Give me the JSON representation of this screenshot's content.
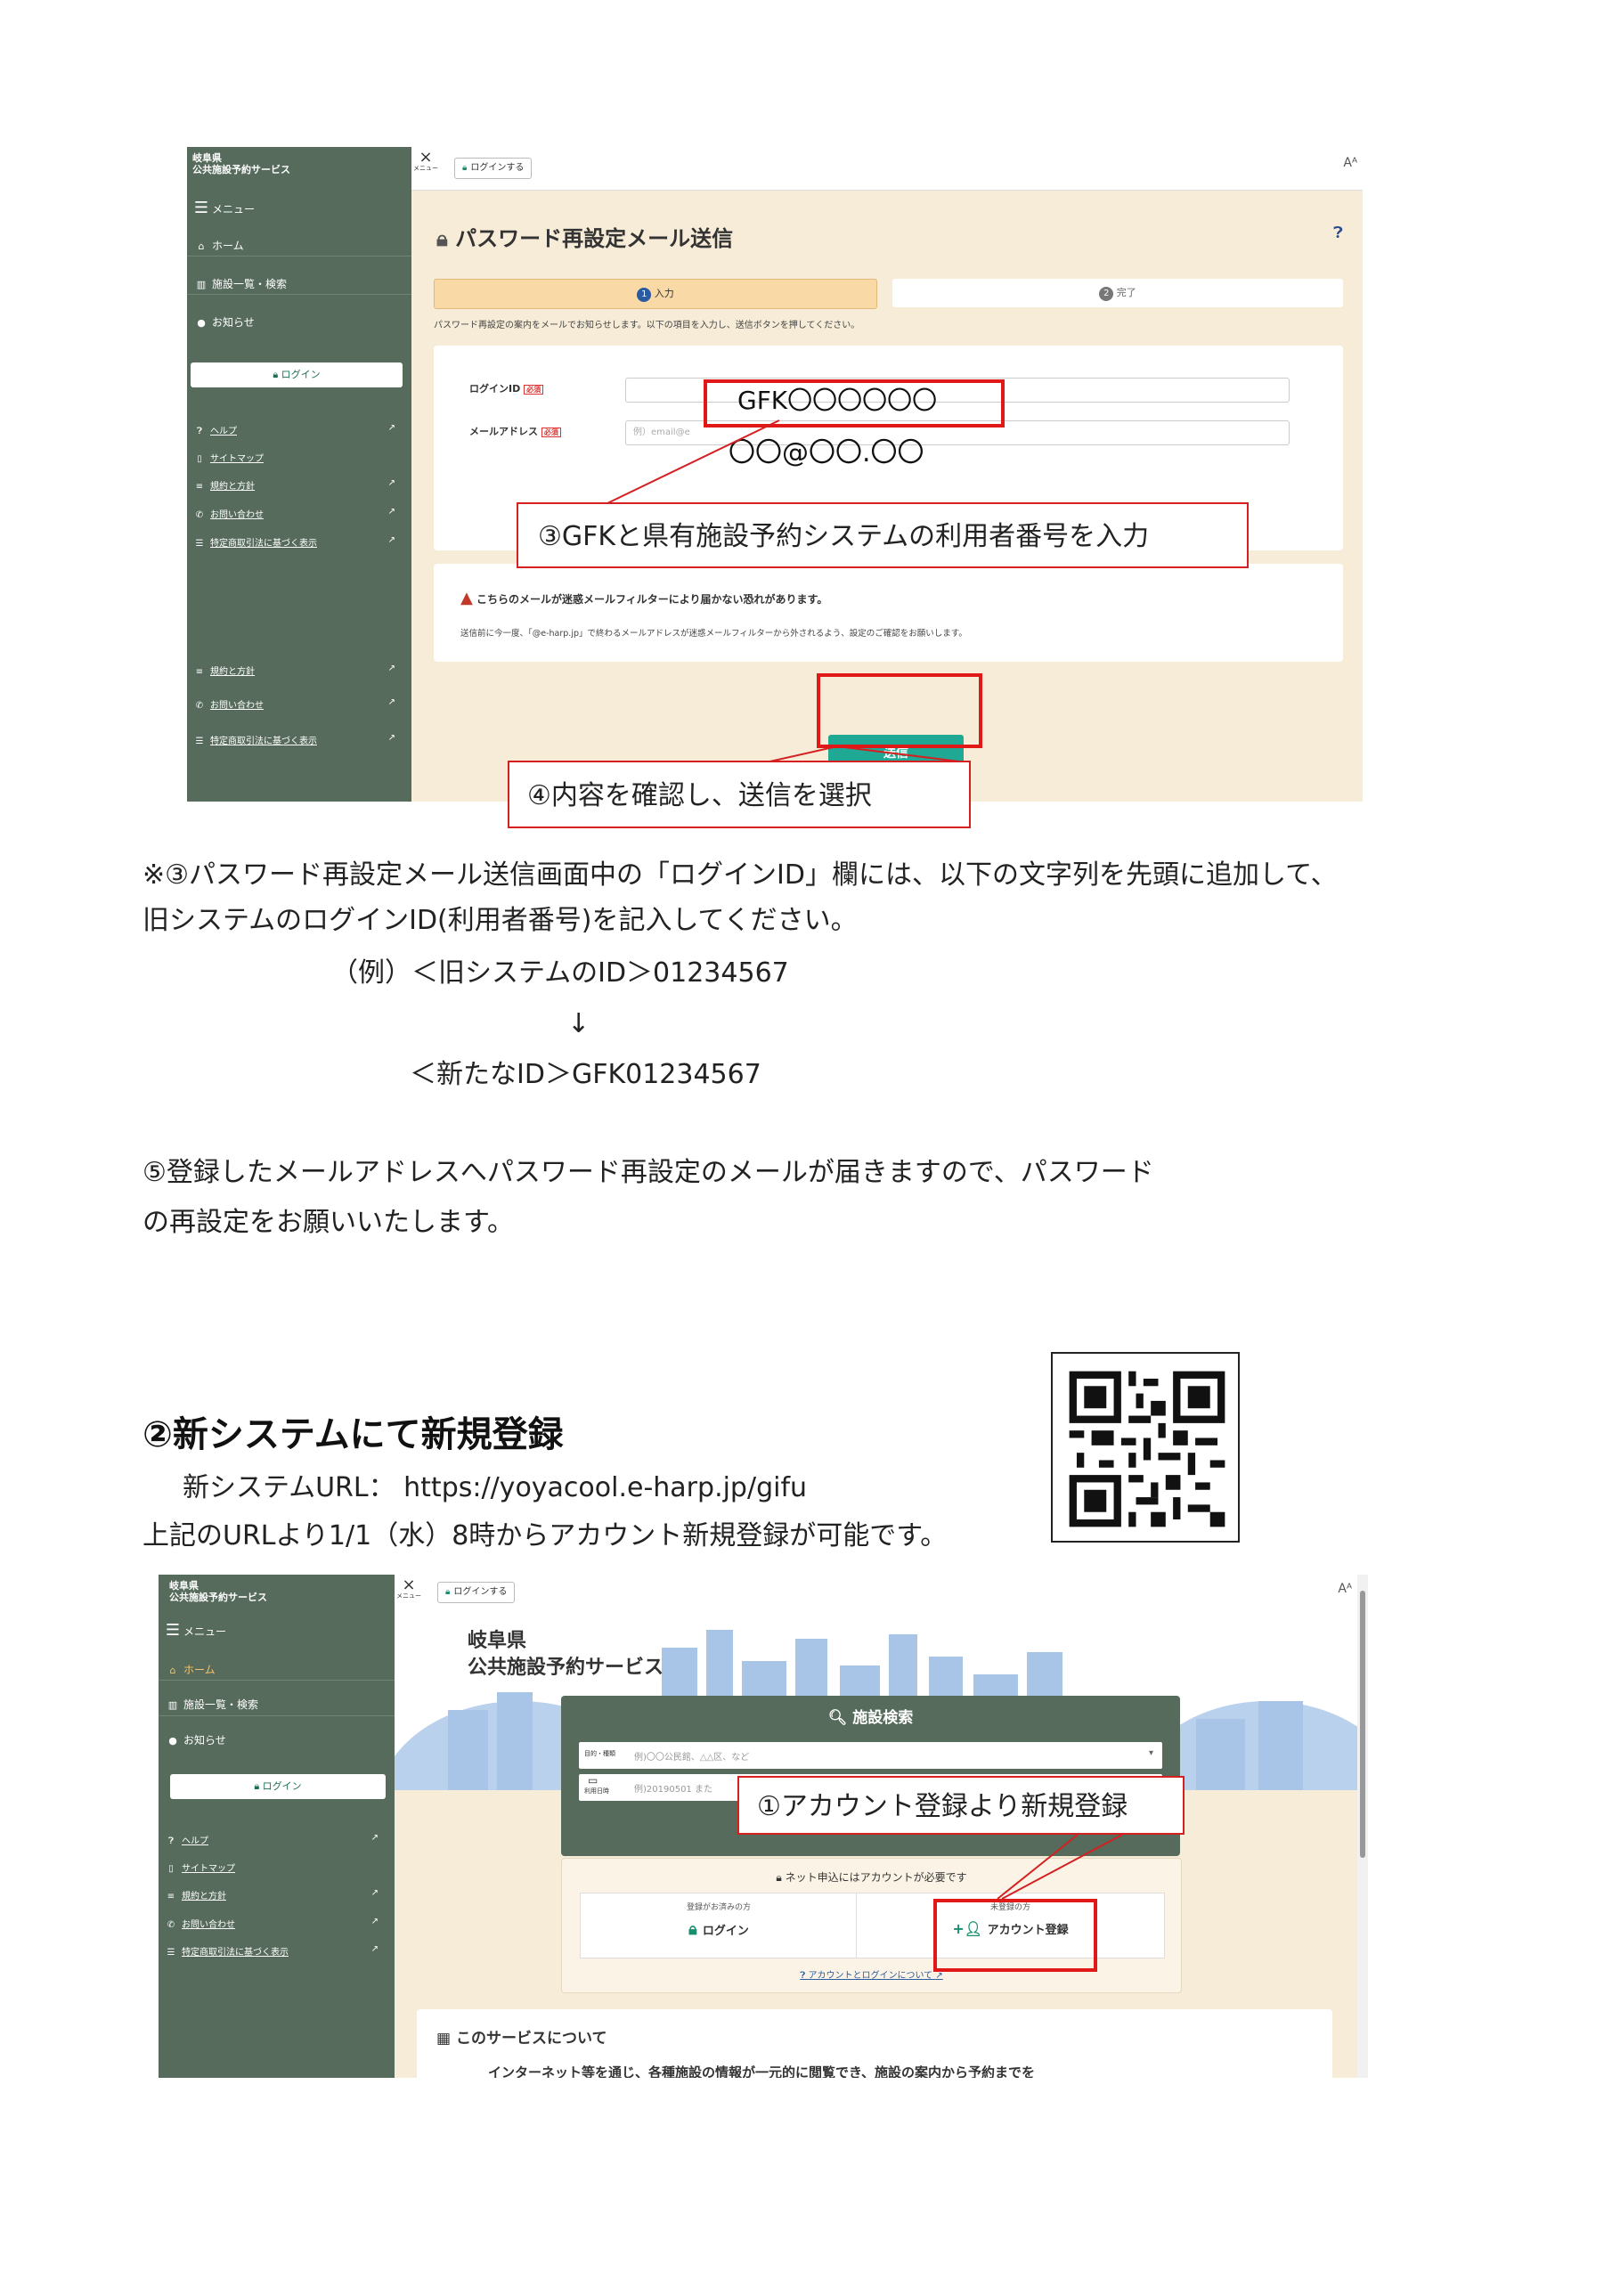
{
  "shot1": {
    "brand": "岐阜県\n公共施設予約サービス",
    "menu_label": "メニュー",
    "top_login": "ログインする",
    "page_title": "パスワード再設定メール送信",
    "steps": [
      {
        "num": "1",
        "label": "入力"
      },
      {
        "num": "2",
        "label": "完了"
      }
    ],
    "instruction": "パスワード再設定の案内をメールでお知らせします。以下の項目を入力し、送信ボタンを押してください。",
    "login_id_label": "ログインID",
    "required": "必須",
    "mail_label": "メールアドレス",
    "mail_placeholder": "例）email@e",
    "login_id_value": "GFK〇〇〇〇〇〇",
    "mail_value": "〇〇@〇〇.〇〇",
    "warning_title": "こちらのメールが迷惑メールフィルターにより届かない恐れがあります。",
    "warning_text": "送信前に今一度、「@e-harp.jp」で終わるメールアドレスが迷惑メールフィルターから外されるよう、設定のご確認をお願いします。",
    "send_button": "送信",
    "callout_input": "③GFKと県有施設予約システムの利用者番号を入力",
    "callout_send": "④内容を確認し、送信を選択",
    "sidebar": {
      "menu": "メニュー",
      "home": "ホーム",
      "facility": "施設一覧・検索",
      "news": "お知らせ",
      "login": "ログイン",
      "links": [
        "ヘルプ",
        "サイトマップ",
        "規約と方針",
        "お問い合わせ",
        "特定商取引法に基づく表示"
      ],
      "links_lower": [
        "規約と方針",
        "お問い合わせ",
        "特定商取引法に基づく表示"
      ]
    }
  },
  "text": {
    "note_line1": "※③パスワード再設定メール送信画面中の「ログインID」欄には、以下の文字列を先頭に追加して、",
    "note_line2": "旧システムのログインID(利用者番号)を記入してください。",
    "example_old": "（例）＜旧システムのID＞01234567",
    "arrow": "↓",
    "example_new": "＜新たなID＞GFK01234567",
    "step5_line1": "⑤登録したメールアドレスへパスワード再設定のメールが届きますので、パスワード",
    "step5_line2": "の再設定をお願いいたします。",
    "section2_heading": "②新システムにて新規登録",
    "url_line": "新システムURL： https://yoyacool.e-harp.jp/gifu",
    "avail_line": "上記のURLより1/1（水）8時からアカウント新規登録が可能です。"
  },
  "shot2": {
    "brand": "岐阜県\n公共施設予約サービス",
    "menu_label": "メニュー",
    "top_login": "ログインする",
    "hero_title_1": "岐阜県",
    "hero_title_2": "公共施設予約サービス",
    "search_title": "施設検索",
    "search_row1_label": "目的・種類",
    "search_row1_placeholder": "例)〇〇公民館、△△区、など",
    "search_row2_label": "利用日時",
    "search_row2_placeholder": "例)20190501 また",
    "account_note": "ネット申込にはアカウントが必要です",
    "registered_caption": "登録がお済みの方",
    "login_button": "ログイン",
    "unregistered_caption": "未登録の方",
    "register_button": "アカウント登録",
    "about_link": "アカウントとログインについて",
    "service_heading": "このサービスについて",
    "service_text": "インターネット等を通じ、各種施設の情報が一元的に閲覧でき、施設の案内から予約までを",
    "callout_register": "①アカウント登録より新規登録",
    "sidebar": {
      "menu": "メニュー",
      "home": "ホーム",
      "facility": "施設一覧・検索",
      "news": "お知らせ",
      "login": "ログイン",
      "links": [
        "ヘルプ",
        "サイトマップ",
        "規約と方針",
        "お問い合わせ",
        "特定商取引法に基づく表示"
      ]
    }
  },
  "colors": {
    "sidebar": "#566b5c",
    "beige": "#f7ecd7",
    "teal_button": "#1fa894",
    "annotation_red": "#e01818",
    "step_active": "#f9d9a6"
  }
}
